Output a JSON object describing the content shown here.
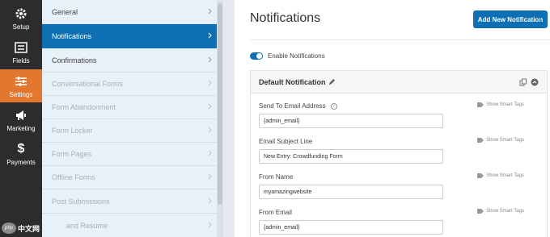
{
  "rail": {
    "items": [
      {
        "label": "Setup",
        "icon": "gear-icon",
        "active": false
      },
      {
        "label": "Fields",
        "icon": "fields-icon",
        "active": false
      },
      {
        "label": "Settings",
        "icon": "sliders-icon",
        "active": true
      },
      {
        "label": "Marketing",
        "icon": "megaphone-icon",
        "active": false
      },
      {
        "label": "Payments",
        "icon": "dollar-icon",
        "active": false
      }
    ]
  },
  "submenu": {
    "items": [
      {
        "label": "General",
        "state": "normal"
      },
      {
        "label": "Notifications",
        "state": "active"
      },
      {
        "label": "Confirmations",
        "state": "normal"
      },
      {
        "label": "Conversational Forms",
        "state": "disabled"
      },
      {
        "label": "Form Abandonment",
        "state": "disabled"
      },
      {
        "label": "Form Locker",
        "state": "disabled"
      },
      {
        "label": "Form Pages",
        "state": "disabled"
      },
      {
        "label": "Offline Forms",
        "state": "disabled"
      },
      {
        "label": "Post Submissions",
        "state": "disabled"
      },
      {
        "label": "and Resume",
        "state": "disabled"
      }
    ]
  },
  "main": {
    "title": "Notifications",
    "add_button": "Add New Notification",
    "enable_label": "Enable Notifications",
    "card": {
      "title": "Default Notification",
      "smart_tags_label": "Show Smart Tags",
      "fields": [
        {
          "label": "Send To Email Address",
          "value": "{admin_email}",
          "help": true
        },
        {
          "label": "Email Subject Line",
          "value": "New Entry: Crowdfunding Form",
          "help": false
        },
        {
          "label": "From Name",
          "value": "myamazingwebsite",
          "help": false
        },
        {
          "label": "From Email",
          "value": "{admin_email}",
          "help": false
        }
      ]
    }
  },
  "watermark": {
    "logo": "php",
    "text": "中文网"
  },
  "colors": {
    "accent": "#0e6fb4",
    "active_rail": "#e27730",
    "rail_bg": "#2c2c2c"
  }
}
